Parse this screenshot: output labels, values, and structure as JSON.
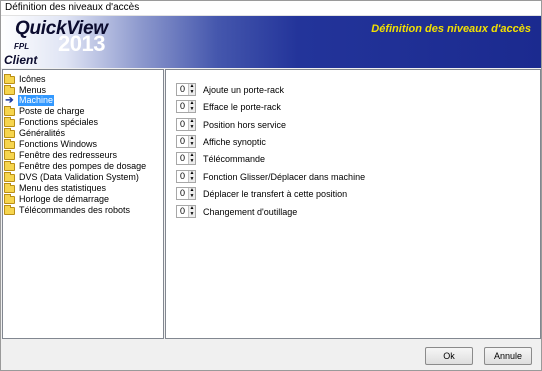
{
  "window": {
    "title": "Définition des niveaux d'accès"
  },
  "banner": {
    "logo_main": "QuickView",
    "logo_sub": "FPL",
    "logo_year": "2013",
    "logo_client": "Client",
    "title": "Définition des niveaux d'accès",
    "title_color": "#f3e000"
  },
  "tree": {
    "items": [
      {
        "label": "Icônes",
        "icon": "folder-icon"
      },
      {
        "label": "Menus",
        "icon": "folder-icon"
      },
      {
        "label": "Machine",
        "icon": "arrow-icon",
        "selected": true
      },
      {
        "label": "Poste de charge",
        "icon": "folder-icon"
      },
      {
        "label": "Fonctions spéciales",
        "icon": "folder-icon"
      },
      {
        "label": "Généralités",
        "icon": "folder-icon"
      },
      {
        "label": "Fonctions Windows",
        "icon": "folder-icon"
      },
      {
        "label": "Fenêtre des redresseurs",
        "icon": "folder-icon"
      },
      {
        "label": "Fenêtre des pompes de dosage",
        "icon": "folder-icon"
      },
      {
        "label": "DVS (Data Validation System)",
        "icon": "folder-icon"
      },
      {
        "label": "Menu des statistiques",
        "icon": "folder-icon"
      },
      {
        "label": "Horloge de démarrage",
        "icon": "folder-icon"
      },
      {
        "label": "Télécommandes des robots",
        "icon": "folder-icon"
      }
    ]
  },
  "permissions": {
    "rows": [
      {
        "value": "0",
        "label": "Ajoute un porte-rack"
      },
      {
        "value": "0",
        "label": "Efface le porte-rack"
      },
      {
        "value": "0",
        "label": "Position hors service"
      },
      {
        "value": "0",
        "label": "Affiche synoptic"
      },
      {
        "value": "0",
        "label": "Télécommande"
      },
      {
        "value": "0",
        "label": "Fonction Glisser/Déplacer dans machine"
      },
      {
        "value": "0",
        "label": "Déplacer le transfert à cette position"
      },
      {
        "value": "0",
        "label": "Changement d'outillage"
      }
    ]
  },
  "buttons": {
    "ok": "Ok",
    "cancel": "Annule"
  },
  "colors": {
    "selection": "#3399ff",
    "banner_dark": "#1b2a8f"
  }
}
